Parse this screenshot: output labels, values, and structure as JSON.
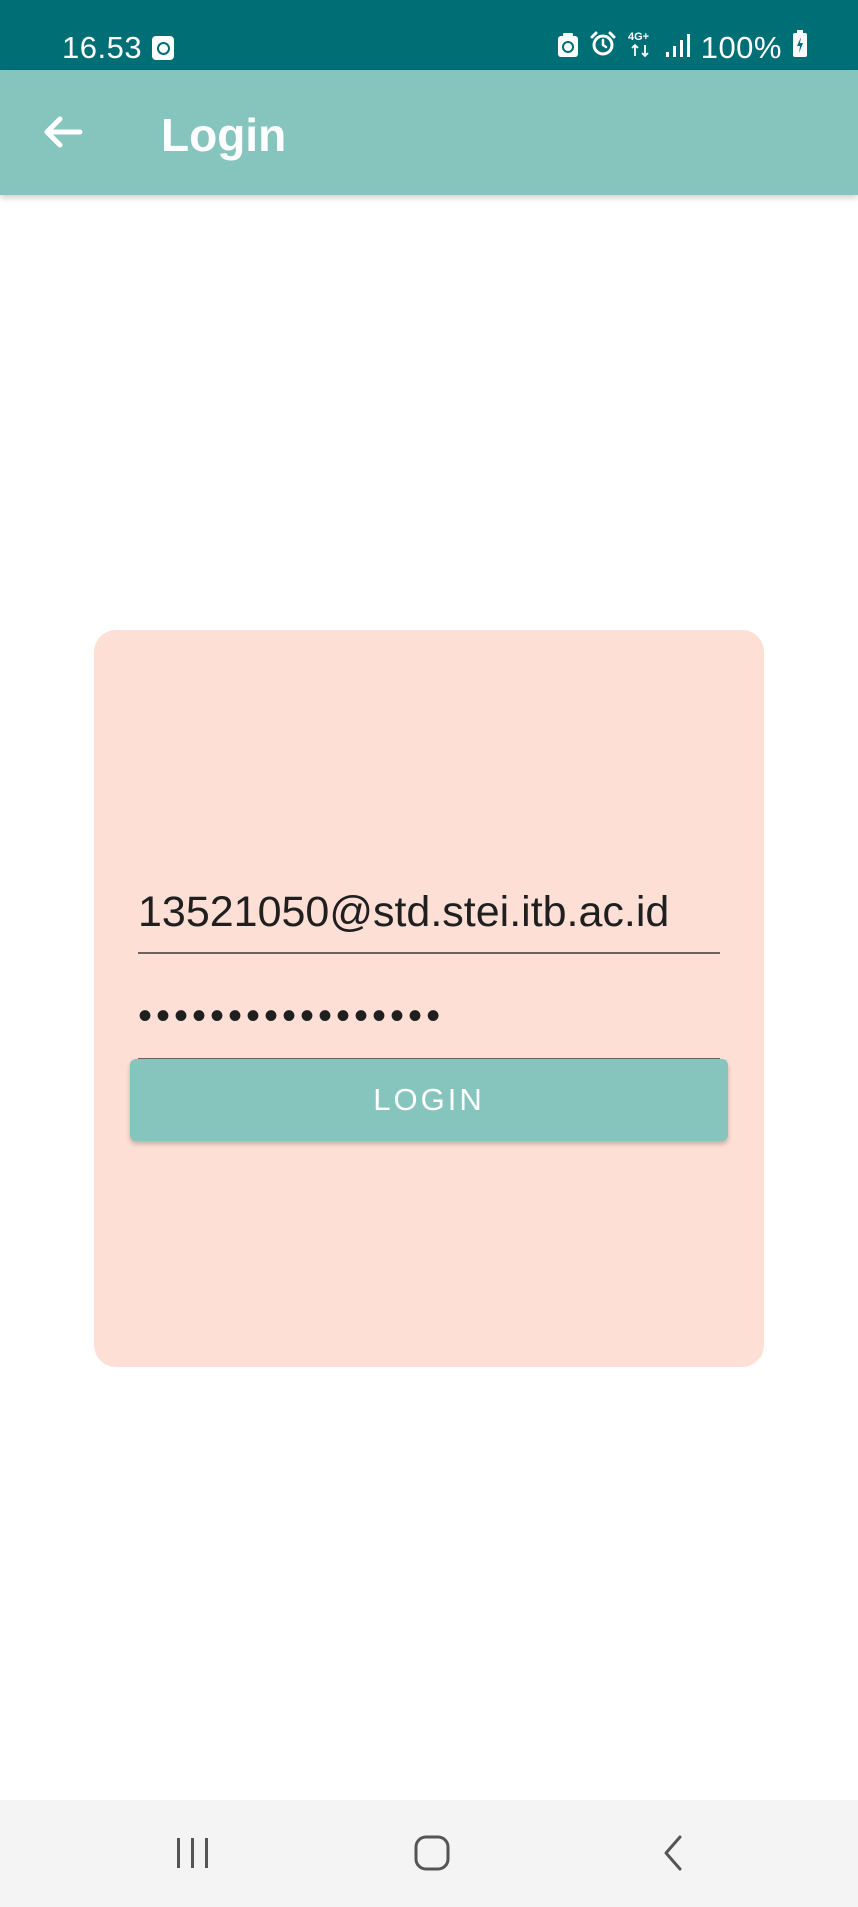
{
  "status_bar": {
    "time": "16.53",
    "network": "4G+",
    "battery": "100%",
    "icons": [
      "screen-record-icon",
      "recycle-icon",
      "alarm-icon",
      "network-4g-icon",
      "signal-icon",
      "battery-charging-icon"
    ]
  },
  "app_bar": {
    "title": "Login",
    "back_icon": "arrow-left-icon"
  },
  "login_form": {
    "email_value": "13521050@std.stei.itb.ac.id",
    "password_value": "•••••••••••••••••",
    "button_label": "LOGIN"
  },
  "nav_bar": {
    "icons": [
      "recents-icon",
      "home-icon",
      "back-icon"
    ]
  },
  "colors": {
    "status_bar": "#006e75",
    "app_bar": "#86c5be",
    "card": "#fddfd6",
    "button": "#86c5be",
    "nav_bar": "#f4f4f4"
  }
}
